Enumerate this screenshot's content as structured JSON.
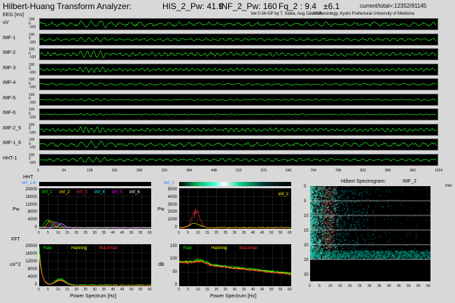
{
  "header": {
    "app_title": "Hilbert-Huang Transform Analyzer:",
    "his_pw": "HIS_2_Pw: 41.9",
    "inf_pw": "INF_2_Pw: 160",
    "fq": "Fq_2 : 9.4",
    "sd": "±6.1",
    "current_total": "current/total=:12352/91145",
    "version": "Ver.0.34-GP by T. Sawa, Aug 11, 2016",
    "dept": "Anesthesiology, Kyoto Prefectural University of Medicine"
  },
  "trace_unit": "EEG [ms]",
  "traces": [
    {
      "label": "uV",
      "amp": 0.55
    },
    {
      "label": "IMF-1",
      "amp": 0.35
    },
    {
      "label": "IMF-2",
      "amp": 0.5
    },
    {
      "label": "IMF-3",
      "amp": 0.4
    },
    {
      "label": "IMF-4",
      "amp": 0.25
    },
    {
      "label": "IMF-5",
      "amp": 0.18
    },
    {
      "label": "IMF-6",
      "amp": 0.14
    },
    {
      "label": "IMF-2_5",
      "amp": 0.45
    },
    {
      "label": "IMF-1_6",
      "amp": 0.5
    },
    {
      "label": "HHT-1",
      "amp": 0.4
    }
  ],
  "trace_scale": [
    "100",
    "0",
    "-100"
  ],
  "time_axis": [
    "0",
    "64",
    "128",
    "192",
    "256",
    "320",
    "384",
    "448",
    "512",
    "576",
    "640",
    "704",
    "768",
    "832",
    "896",
    "960",
    "1024"
  ],
  "hht_section": {
    "label": "HHT",
    "selector_left": "imf_1-6",
    "selector_right": "imf_2",
    "legend_left": [
      "imf_1",
      "imf_2",
      "imf_3",
      "imf_4",
      "imf_5",
      "imf_6"
    ],
    "legend_left_colors": [
      "#00ff00",
      "#ffff00",
      "#ff3030",
      "#00ffff",
      "#ff00ff",
      "#ffffff"
    ],
    "legend_right": "imf_2",
    "y_label": "Pw",
    "left_y": [
      "20000",
      "16000",
      "12000",
      "8000",
      "4000",
      "0"
    ],
    "right_y": [
      "5000",
      "4000",
      "3000",
      "2000",
      "1000",
      "0"
    ]
  },
  "fft_section": {
    "label": "FFT",
    "legend": [
      "Raw",
      "Hanning",
      "Blackman"
    ],
    "legend_colors": [
      "#00ff00",
      "#ffff00",
      "#ff3030"
    ],
    "left_ylabel": "uV^2",
    "right_ylabel": "dB",
    "left_y": [
      "20000",
      "16000",
      "12000",
      "8000",
      "4000",
      "0"
    ],
    "right_y": [
      "150",
      "100",
      "50",
      "0"
    ]
  },
  "freq_ticks": [
    "0",
    "5",
    "10",
    "15",
    "20",
    "25",
    "30",
    "35",
    "40",
    "45",
    "50",
    "55",
    "60"
  ],
  "x_label": "Power Spectrum [Hz]",
  "spectrogram": {
    "title": "Hilbert Spectrogram:",
    "channel": "IMF_2",
    "unit": "min",
    "y_ticks": [
      "0",
      "5",
      "10",
      "15",
      "20",
      "25",
      "30"
    ],
    "x_ticks": [
      "0",
      "5",
      "10",
      "15",
      "20",
      "25",
      "30",
      "35",
      "40",
      "45",
      "50",
      "55",
      "60"
    ]
  }
}
